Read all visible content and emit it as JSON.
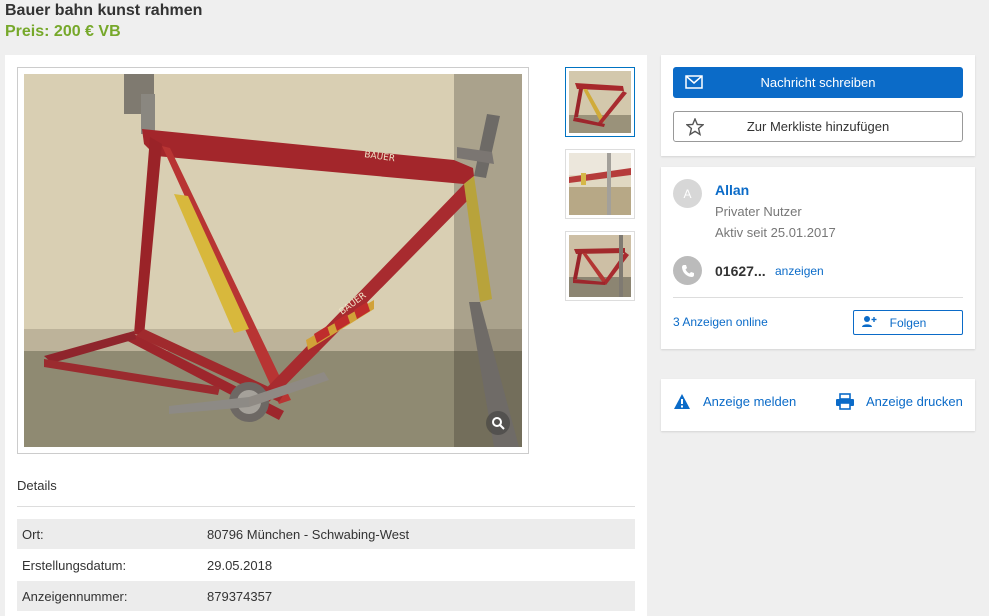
{
  "listing": {
    "title": "Bauer bahn kunst rahmen",
    "price": "Preis: 200 € VB"
  },
  "gallery": {
    "thumb_count": 3,
    "frame_text": "BAUER"
  },
  "details": {
    "heading": "Details",
    "rows": [
      {
        "label": "Ort:",
        "value": "80796 München - Schwabing-West"
      },
      {
        "label": "Erstellungsdatum:",
        "value": "29.05.2018"
      },
      {
        "label": "Anzeigennummer:",
        "value": "879374357"
      }
    ]
  },
  "actions": {
    "message_label": "Nachricht schreiben",
    "watchlist_label": "Zur Merkliste hinzufügen"
  },
  "seller": {
    "initial": "A",
    "name": "Allan",
    "type": "Privater Nutzer",
    "since": "Aktiv seit 25.01.2017",
    "phone": "01627...",
    "phone_show": "anzeigen",
    "ads_online": "3 Anzeigen online",
    "follow_label": "Folgen"
  },
  "footer_actions": {
    "report_label": "Anzeige melden",
    "print_label": "Anzeige drucken"
  },
  "colors": {
    "accent": "#0b6bc8",
    "price": "#76a82a"
  }
}
